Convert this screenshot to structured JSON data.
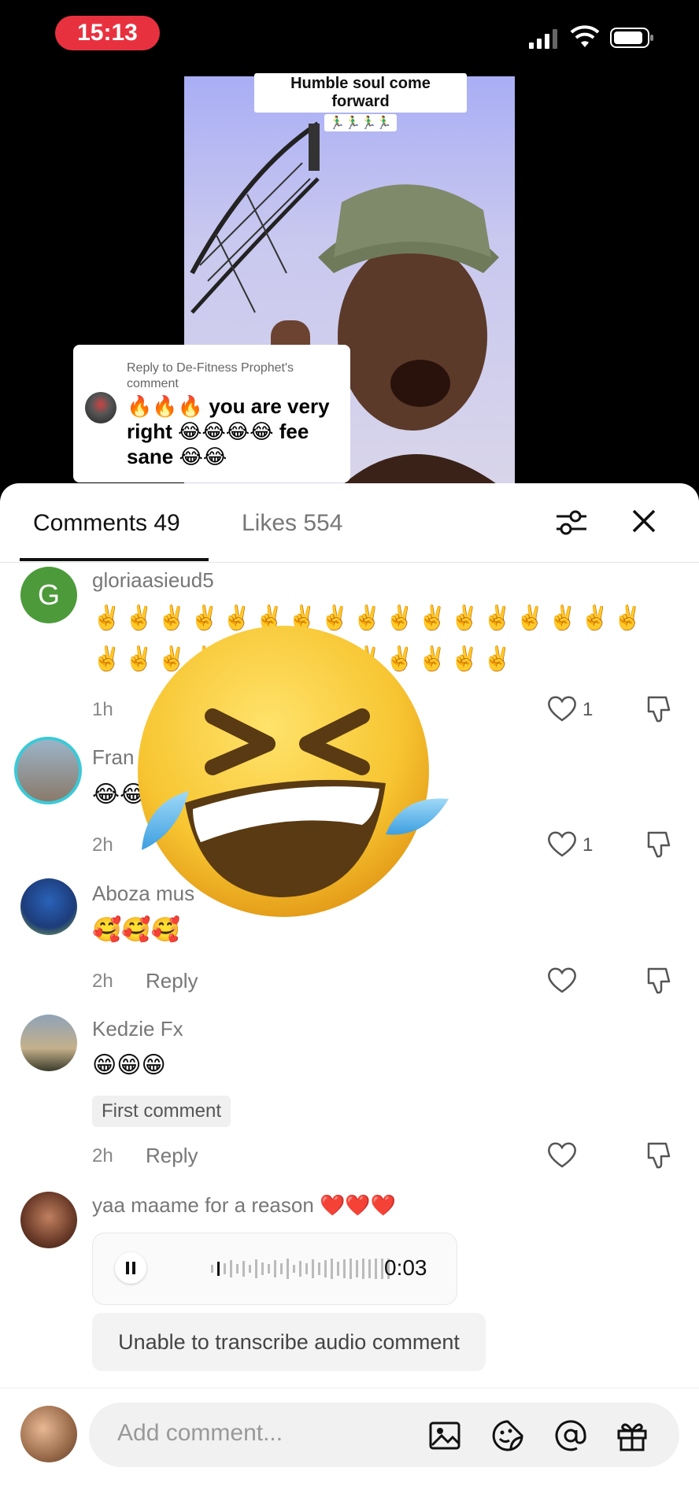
{
  "status_bar": {
    "time": "15:13"
  },
  "video": {
    "caption_line1": "Humble soul come forward",
    "caption_line2": "🏃‍♂️🏃‍♂️🏃‍♂️🏃‍♂️"
  },
  "reply_card": {
    "header": "Reply to De-Fitness Prophet's comment",
    "text": "🔥🔥🔥 you are very right 😂😂😂😂 fee sane 😂😂"
  },
  "tabs": {
    "comments": "Comments 49",
    "likes": "Likes 554"
  },
  "comments": [
    {
      "username": "gloriaasieud5",
      "avatar_letter": "G",
      "text": "✌️✌️✌️✌️✌️✌️✌️✌️✌️✌️✌️✌️✌️✌️✌️✌️✌️✌️✌️✌️✌️✌️✌️✌️✌️✌️✌️✌️✌️✌️",
      "time": "1h",
      "likes": "1"
    },
    {
      "username": "Fran",
      "text": "😂😂",
      "time": "2h",
      "likes": "1"
    },
    {
      "username": "Aboza mus",
      "text": "🥰🥰🥰",
      "time": "2h",
      "reply": "Reply",
      "likes": ""
    },
    {
      "username": "Kedzie Fx",
      "text": "😁😁😁",
      "badge": "First comment",
      "time": "2h",
      "reply": "Reply",
      "likes": ""
    },
    {
      "username": "yaa maame for a reason ❤️❤️❤️",
      "audio_duration": "0:03",
      "transcribe_note": "Unable to transcribe audio comment"
    }
  ],
  "input": {
    "placeholder": "Add comment..."
  },
  "overlay_emoji": "rolling-on-floor-laughing"
}
